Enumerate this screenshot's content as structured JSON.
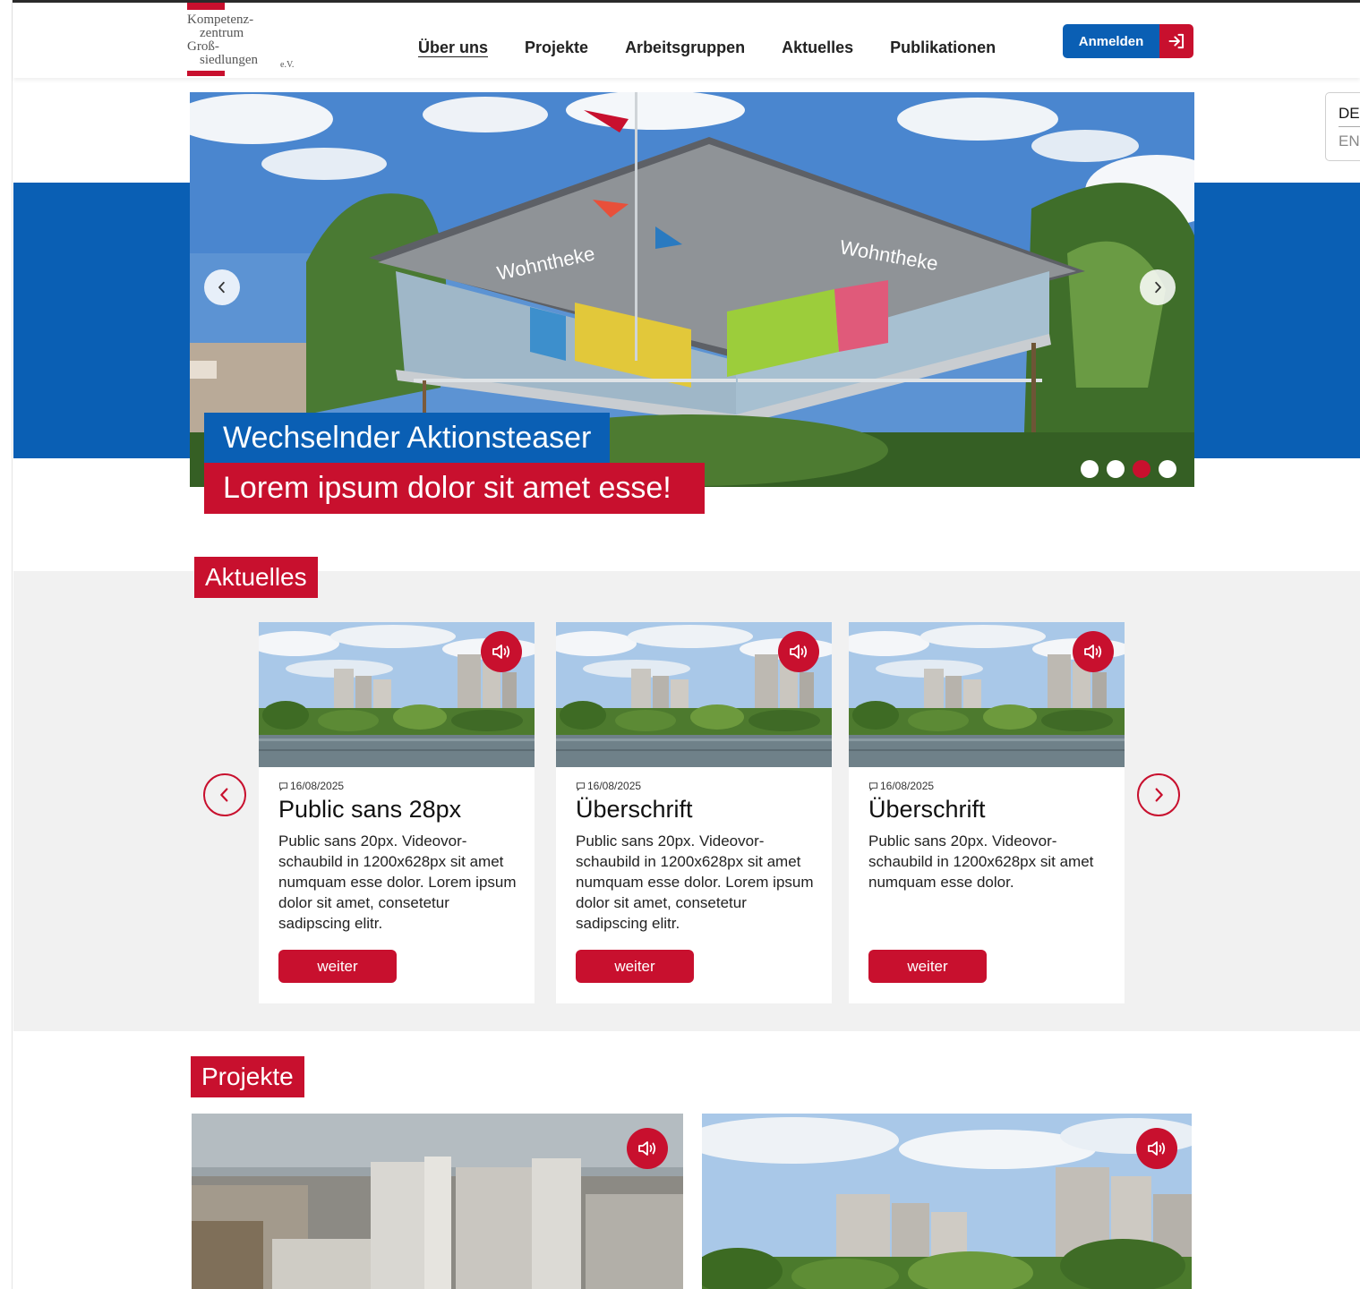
{
  "header": {
    "logo_lines": [
      "Kompetenz-",
      "zentrum",
      "Groß-",
      "siedlungen"
    ],
    "logo_suffix": "e.V.",
    "nav": [
      "Über uns",
      "Projekte",
      "Arbeitsgruppen",
      "Aktuelles",
      "Publikationen"
    ],
    "login_label": "Anmelden"
  },
  "language": {
    "current": "DE",
    "other": "EN"
  },
  "hero": {
    "teaser_line1": "Wechselnder Aktionsteaser",
    "teaser_line2": "Lorem ipsum dolor sit amet esse!",
    "slide_count": 4,
    "active_slide": 3,
    "building_sign": "Wohntheke"
  },
  "news": {
    "title": "Aktuelles",
    "cards": [
      {
        "date": "16/08/2025",
        "title": "Public sans 28px",
        "text": "Public sans 20px. Videovor-schaubild in 1200x628px sit amet numquam esse dolor. Lorem ipsum dolor sit amet, consetetur sadipscing elitr.",
        "button": "weiter"
      },
      {
        "date": "16/08/2025",
        "title": "Überschrift",
        "text": "Public sans 20px. Videovor-schaubild in 1200x628px sit amet numquam esse dolor. Lorem ipsum dolor sit amet, consetetur sadipscing elitr.",
        "button": "weiter"
      },
      {
        "date": "16/08/2025",
        "title": "Überschrift",
        "text": "Public sans 20px. Videovor-schaubild in 1200x628px sit amet numquam esse dolor.",
        "button": "weiter"
      }
    ]
  },
  "projects": {
    "title": "Projekte"
  },
  "icons": {
    "login": "login-arrow-icon",
    "audio": "speaker-icon",
    "date": "comment-icon",
    "prev": "chevron-left-icon",
    "next": "chevron-right-icon"
  },
  "colors": {
    "primary_red": "#c8102e",
    "primary_blue": "#0a5fb4",
    "section_gray": "#f1f1f1"
  }
}
